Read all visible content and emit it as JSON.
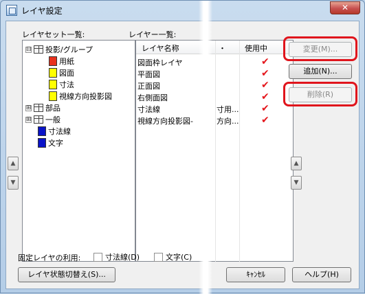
{
  "window": {
    "title": "レイヤ設定",
    "close_glyph": "✕"
  },
  "labels": {
    "layerset_list": "レイヤセット一覧:",
    "layer_list": "レイヤー一覧:"
  },
  "tree": [
    {
      "label": "投影/グループ",
      "kind": "group",
      "expander": "⊟"
    },
    {
      "label": "用紙",
      "kind": "swatch",
      "color": "#e8321e"
    },
    {
      "label": "図面",
      "kind": "swatch",
      "color": "#ffff00"
    },
    {
      "label": "寸法",
      "kind": "swatch",
      "color": "#ffff00"
    },
    {
      "label": "視線方向投影図",
      "kind": "swatch",
      "color": "#ffff00"
    },
    {
      "label": "部品",
      "kind": "group",
      "expander": "⊞"
    },
    {
      "label": "一般",
      "kind": "group",
      "expander": "⊞"
    },
    {
      "label": "寸法線",
      "kind": "swatch",
      "color": "#0a14c8"
    },
    {
      "label": "文字",
      "kind": "swatch",
      "color": "#0a14c8"
    }
  ],
  "layer_table": {
    "columns": [
      "レイヤ名称",
      "・",
      "使用中"
    ],
    "rows": [
      {
        "name": "図面枠レイヤ",
        "mid": "",
        "in_use": "✔"
      },
      {
        "name": "平面図",
        "mid": "",
        "in_use": "✔"
      },
      {
        "name": "正面図",
        "mid": "",
        "in_use": "✔"
      },
      {
        "name": "右側面図",
        "mid": "",
        "in_use": "✔"
      },
      {
        "name": "寸法線",
        "mid": "寸用...",
        "in_use": "✔"
      },
      {
        "name": "視線方向投影図-",
        "mid": "方向...",
        "in_use": "✔"
      }
    ]
  },
  "buttons": {
    "change": "変更(M)...",
    "add": "追加(N)...",
    "delete": "削除(R)",
    "switch_state": "レイヤ状態切替え(S)...",
    "cancel": "ｷｬﾝｾﾙ",
    "help": "ヘルプ(H)"
  },
  "fixed_layer": {
    "label": "固定レイヤの利用:",
    "dim_line": "寸法線(D)",
    "text": "文字(C)"
  },
  "arrows": {
    "up": "▲",
    "down": "▼"
  },
  "colors": {
    "highlight": "#e0141c",
    "check": "#e4161c"
  }
}
